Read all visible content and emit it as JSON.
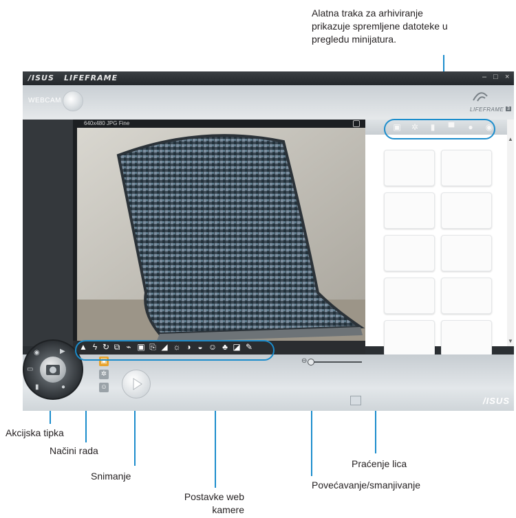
{
  "callouts": {
    "archive_toolbar": {
      "line1": "Alatna traka za arhiviranje",
      "line2": "prikazuje spremljene datoteke u",
      "line3": "pregledu minijatura."
    },
    "action_key": "Akcijska tipka",
    "modes": "Načini rada",
    "record": "Snimanje",
    "webcam_settings": {
      "line1": "Postavke web",
      "line2": "kamere"
    },
    "face_tracking": "Praćenje lica",
    "zoom": "Povećavanje/smanjivanje"
  },
  "app": {
    "brand_asus": "/ISUS",
    "brand_lifeframe": "LIFEFRAME",
    "window_controls": [
      "–",
      "□",
      "×"
    ],
    "header_webcam": "WEBCAM",
    "header_logo": "LIFEFRAME",
    "header_logo_version": "3",
    "preview_resolution": "640x480 JPG Fine",
    "bottom_logo": "/ISUS"
  },
  "archive_toolbar_icons": [
    "camera-icon",
    "settings-icon",
    "id-icon",
    "movie-icon",
    "microphone-icon",
    "eye-icon"
  ],
  "webcam_settings_icons": [
    "scene-icon",
    "flash-icon",
    "timer-icon",
    "burst-icon",
    "tag-icon",
    "frame-icon",
    "export-icon",
    "sharpness-icon",
    "brightness-icon",
    "contrast-icon",
    "shield-icon",
    "face-icon",
    "effects-icon",
    "color-icon",
    "tools-icon"
  ],
  "mode_icons": [
    "photo-mode-icon",
    "settings-mode-icon",
    "face-mode-icon"
  ],
  "colors": {
    "callout_line": "#1a8ccc",
    "window_dark": "#2b2f33",
    "mode_active": "#e8a32c"
  }
}
